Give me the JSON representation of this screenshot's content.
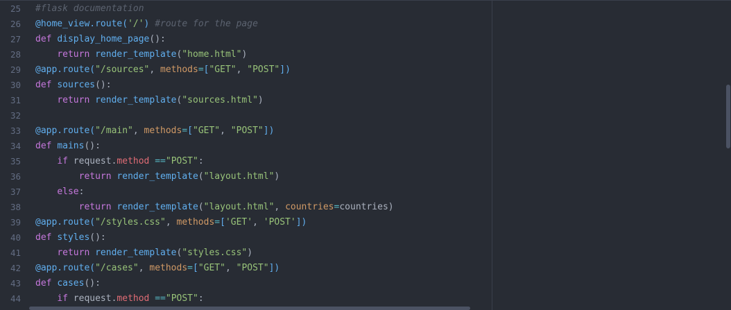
{
  "editor": {
    "language": "python",
    "colors": {
      "background": "#282c34",
      "comment": "#5c6370",
      "keyword": "#c678dd",
      "function": "#61afef",
      "string": "#98c379",
      "property": "#e06c75",
      "parameter": "#d19a66",
      "operator": "#56b6c2",
      "line_number": "#636d83"
    },
    "lines": [
      {
        "number": "25",
        "tokens": [
          {
            "t": "comment",
            "v": "#flask documentation"
          }
        ]
      },
      {
        "number": "26",
        "tokens": [
          {
            "t": "deco",
            "v": "@home_view.route("
          },
          {
            "t": "str",
            "v": "'/'"
          },
          {
            "t": "deco",
            "v": ")"
          },
          {
            "t": "punct",
            "v": " "
          },
          {
            "t": "comment",
            "v": "#route for the page"
          }
        ]
      },
      {
        "number": "27",
        "tokens": [
          {
            "t": "kw",
            "v": "def "
          },
          {
            "t": "fn",
            "v": "display_home_page"
          },
          {
            "t": "punct",
            "v": "():"
          }
        ]
      },
      {
        "number": "28",
        "tokens": [
          {
            "t": "punct",
            "v": "    "
          },
          {
            "t": "kw",
            "v": "return "
          },
          {
            "t": "fn",
            "v": "render_template"
          },
          {
            "t": "punct",
            "v": "("
          },
          {
            "t": "str",
            "v": "\"home.html\""
          },
          {
            "t": "punct",
            "v": ")"
          }
        ]
      },
      {
        "number": "29",
        "tokens": [
          {
            "t": "deco",
            "v": "@app.route("
          },
          {
            "t": "str",
            "v": "\"/sources\""
          },
          {
            "t": "punct",
            "v": ", "
          },
          {
            "t": "param",
            "v": "methods"
          },
          {
            "t": "op",
            "v": "="
          },
          {
            "t": "deco",
            "v": "["
          },
          {
            "t": "str",
            "v": "\"GET\""
          },
          {
            "t": "punct",
            "v": ", "
          },
          {
            "t": "str",
            "v": "\"POST\""
          },
          {
            "t": "deco",
            "v": "])"
          }
        ]
      },
      {
        "number": "30",
        "tokens": [
          {
            "t": "kw",
            "v": "def "
          },
          {
            "t": "fn",
            "v": "sources"
          },
          {
            "t": "punct",
            "v": "():"
          }
        ]
      },
      {
        "number": "31",
        "tokens": [
          {
            "t": "punct",
            "v": "    "
          },
          {
            "t": "kw",
            "v": "return "
          },
          {
            "t": "fn",
            "v": "render_template"
          },
          {
            "t": "punct",
            "v": "("
          },
          {
            "t": "str",
            "v": "\"sources.html\""
          },
          {
            "t": "punct",
            "v": ")"
          }
        ]
      },
      {
        "number": "32",
        "tokens": []
      },
      {
        "number": "33",
        "tokens": [
          {
            "t": "deco",
            "v": "@app.route("
          },
          {
            "t": "str",
            "v": "\"/main\""
          },
          {
            "t": "punct",
            "v": ", "
          },
          {
            "t": "param",
            "v": "methods"
          },
          {
            "t": "op",
            "v": "="
          },
          {
            "t": "deco",
            "v": "["
          },
          {
            "t": "str",
            "v": "\"GET\""
          },
          {
            "t": "punct",
            "v": ", "
          },
          {
            "t": "str",
            "v": "\"POST\""
          },
          {
            "t": "deco",
            "v": "])"
          }
        ]
      },
      {
        "number": "34",
        "tokens": [
          {
            "t": "kw",
            "v": "def "
          },
          {
            "t": "fn",
            "v": "mains"
          },
          {
            "t": "punct",
            "v": "():"
          }
        ]
      },
      {
        "number": "35",
        "tokens": [
          {
            "t": "punct",
            "v": "    "
          },
          {
            "t": "kw",
            "v": "if "
          },
          {
            "t": "var",
            "v": "request."
          },
          {
            "t": "prop",
            "v": "method"
          },
          {
            "t": "punct",
            "v": " "
          },
          {
            "t": "op",
            "v": "=="
          },
          {
            "t": "str",
            "v": "\"POST\""
          },
          {
            "t": "punct",
            "v": ":"
          }
        ]
      },
      {
        "number": "36",
        "tokens": [
          {
            "t": "punct",
            "v": "        "
          },
          {
            "t": "kw",
            "v": "return "
          },
          {
            "t": "fn",
            "v": "render_template"
          },
          {
            "t": "punct",
            "v": "("
          },
          {
            "t": "str",
            "v": "\"layout.html\""
          },
          {
            "t": "punct",
            "v": ")"
          }
        ]
      },
      {
        "number": "37",
        "tokens": [
          {
            "t": "punct",
            "v": "    "
          },
          {
            "t": "kw",
            "v": "else"
          },
          {
            "t": "punct",
            "v": ":"
          }
        ]
      },
      {
        "number": "38",
        "tokens": [
          {
            "t": "punct",
            "v": "        "
          },
          {
            "t": "kw",
            "v": "return "
          },
          {
            "t": "fn",
            "v": "render_template"
          },
          {
            "t": "punct",
            "v": "("
          },
          {
            "t": "str",
            "v": "\"layout.html\""
          },
          {
            "t": "punct",
            "v": ", "
          },
          {
            "t": "param",
            "v": "countries"
          },
          {
            "t": "op",
            "v": "="
          },
          {
            "t": "var",
            "v": "countries"
          },
          {
            "t": "punct",
            "v": ")"
          }
        ]
      },
      {
        "number": "39",
        "tokens": [
          {
            "t": "deco",
            "v": "@app.route("
          },
          {
            "t": "str",
            "v": "\"/styles.css\""
          },
          {
            "t": "punct",
            "v": ", "
          },
          {
            "t": "param",
            "v": "methods"
          },
          {
            "t": "op",
            "v": "="
          },
          {
            "t": "deco",
            "v": "["
          },
          {
            "t": "str",
            "v": "'GET'"
          },
          {
            "t": "punct",
            "v": ", "
          },
          {
            "t": "str",
            "v": "'POST'"
          },
          {
            "t": "deco",
            "v": "])"
          }
        ]
      },
      {
        "number": "40",
        "tokens": [
          {
            "t": "kw",
            "v": "def "
          },
          {
            "t": "fn",
            "v": "styles"
          },
          {
            "t": "punct",
            "v": "():"
          }
        ]
      },
      {
        "number": "41",
        "tokens": [
          {
            "t": "punct",
            "v": "    "
          },
          {
            "t": "kw",
            "v": "return "
          },
          {
            "t": "fn",
            "v": "render_template"
          },
          {
            "t": "punct",
            "v": "("
          },
          {
            "t": "str",
            "v": "\"styles.css\""
          },
          {
            "t": "punct",
            "v": ")"
          }
        ]
      },
      {
        "number": "42",
        "tokens": [
          {
            "t": "deco",
            "v": "@app.route("
          },
          {
            "t": "str",
            "v": "\"/cases\""
          },
          {
            "t": "punct",
            "v": ", "
          },
          {
            "t": "param",
            "v": "methods"
          },
          {
            "t": "op",
            "v": "="
          },
          {
            "t": "deco",
            "v": "["
          },
          {
            "t": "str",
            "v": "\"GET\""
          },
          {
            "t": "punct",
            "v": ", "
          },
          {
            "t": "str",
            "v": "\"POST\""
          },
          {
            "t": "deco",
            "v": "])"
          }
        ]
      },
      {
        "number": "43",
        "tokens": [
          {
            "t": "kw",
            "v": "def "
          },
          {
            "t": "fn",
            "v": "cases"
          },
          {
            "t": "punct",
            "v": "():"
          }
        ]
      },
      {
        "number": "44",
        "tokens": [
          {
            "t": "punct",
            "v": "    "
          },
          {
            "t": "kw",
            "v": "if "
          },
          {
            "t": "var",
            "v": "request."
          },
          {
            "t": "prop",
            "v": "method"
          },
          {
            "t": "punct",
            "v": " "
          },
          {
            "t": "op",
            "v": "=="
          },
          {
            "t": "str",
            "v": "\"POST\""
          },
          {
            "t": "punct",
            "v": ":"
          }
        ]
      }
    ]
  }
}
